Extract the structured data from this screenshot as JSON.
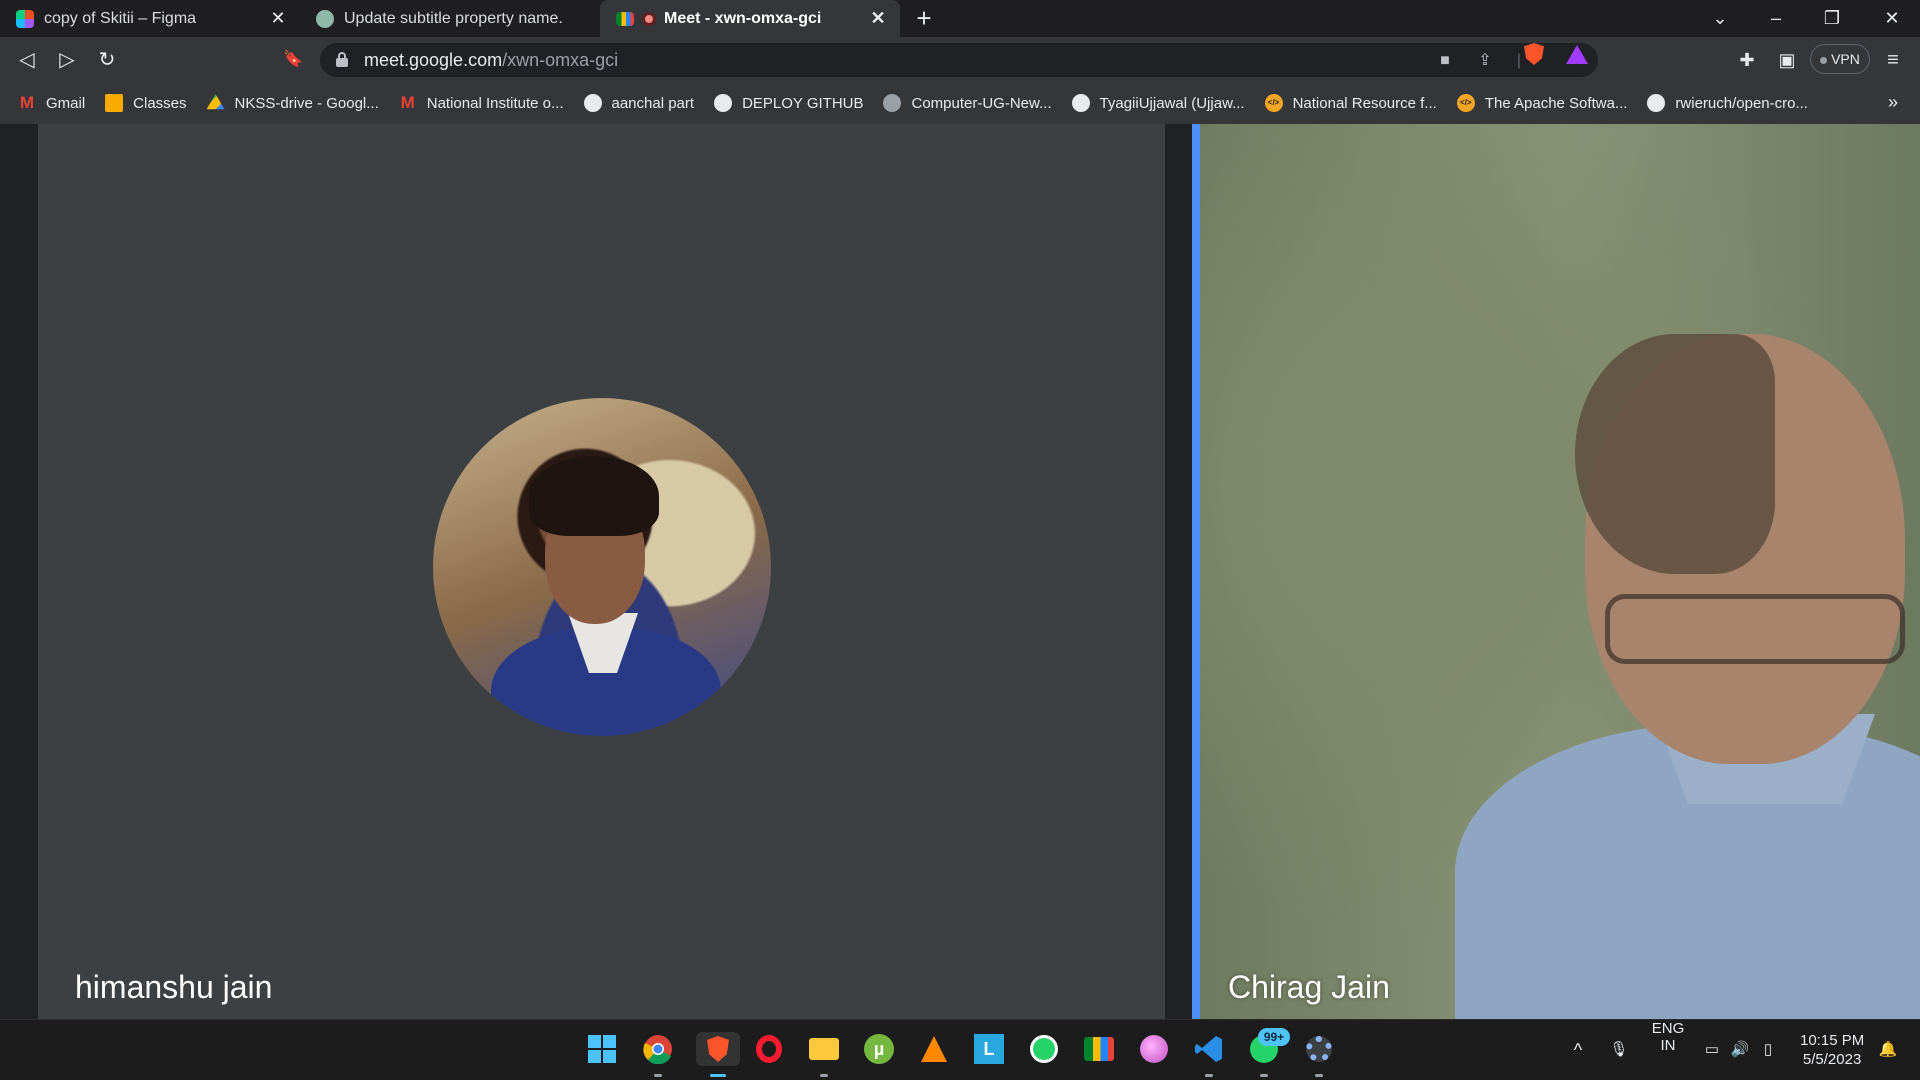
{
  "tabs": [
    {
      "title": "copy of Skitii – Figma",
      "icon": "figma-icon",
      "close": "✕"
    },
    {
      "title": "Update subtitle property name.",
      "icon": "openai-icon"
    },
    {
      "title": "Meet - xwn-omxa-gci",
      "icon": "meet-icon",
      "close": "✕",
      "active": true
    }
  ],
  "new_tab": "+",
  "window_controls": {
    "list": "⌄",
    "minimize": "–",
    "restore": "❐",
    "close": "✕"
  },
  "toolbar": {
    "back": "◁",
    "forward": "▷",
    "reload": "↻",
    "bookmark": "🔖",
    "url_domain": "meet.google.com",
    "url_path": "/xwn-omxa-gci",
    "camera_icon": "■",
    "share_icon": "⇪",
    "extensions": "✚",
    "sidebar": "▣",
    "vpn": "VPN",
    "menu": "≡"
  },
  "bookmarks": [
    {
      "label": "Gmail",
      "icon": "gmail-icon",
      "glyph": "M"
    },
    {
      "label": "Classes",
      "icon": "classroom-icon",
      "glyph": ""
    },
    {
      "label": "NKSS-drive - Googl...",
      "icon": "drive-icon",
      "glyph": ""
    },
    {
      "label": "National Institute o...",
      "icon": "gmail-icon",
      "glyph": "M"
    },
    {
      "label": "aanchal part",
      "icon": "github-icon",
      "glyph": ""
    },
    {
      "label": "DEPLOY GITHUB",
      "icon": "github-icon",
      "glyph": ""
    },
    {
      "label": "Computer-UG-New...",
      "icon": "globe-icon",
      "glyph": ""
    },
    {
      "label": "TyagiiUjjawal (Ujjaw...",
      "icon": "github-icon",
      "glyph": ""
    },
    {
      "label": "National Resource f...",
      "icon": "code-icon",
      "glyph": "</>"
    },
    {
      "label": "The Apache Softwa...",
      "icon": "code-icon",
      "glyph": "</>"
    },
    {
      "label": "rwieruch/open-cro...",
      "icon": "github-icon",
      "glyph": ""
    }
  ],
  "bookmarks_more": "»",
  "meet": {
    "left_name": "himanshu jain",
    "right_name": "Chirag Jain"
  },
  "taskbar": {
    "badge": "99+",
    "lang_top": "ENG",
    "lang_bottom": "IN",
    "time": "10:15 PM",
    "date": "5/5/2023",
    "chevron": "^",
    "mic": "🎙",
    "network": "▭",
    "volume": "🔊",
    "battery": "▯"
  },
  "colors": {
    "speaking_border": "#4e8ef7",
    "tile_bg": "#3c4043",
    "toolbar_bg": "#35363a"
  }
}
